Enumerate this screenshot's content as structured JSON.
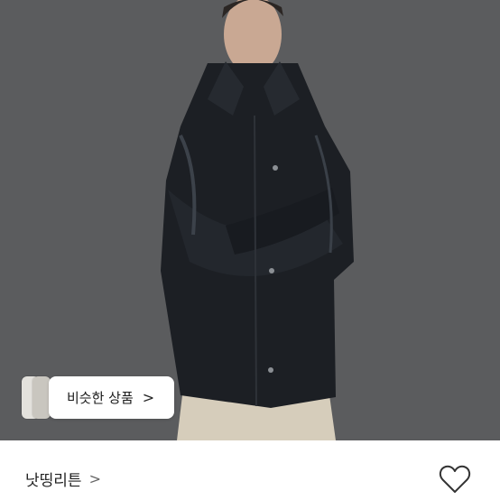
{
  "similar": {
    "label": "비슷한 상품",
    "chevron": ">"
  },
  "shop": {
    "name": "낫띵리튼",
    "chevron": ">"
  },
  "icons": {
    "like": "heart-outline-icon",
    "more": "chevron-right-icon"
  },
  "colors": {
    "background": "#5a5b5d",
    "jacket": "#1c1f24",
    "pants": "#d6cdbb",
    "card": "#ffffff"
  }
}
